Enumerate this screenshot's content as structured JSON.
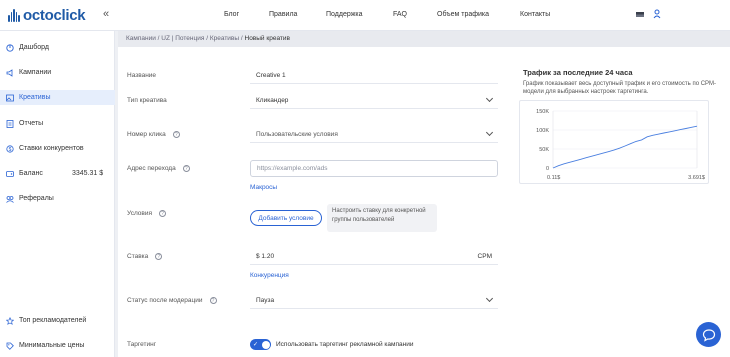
{
  "header": {
    "logo_text": "octoclick",
    "nav": [
      "Блог",
      "Правила",
      "Поддержка",
      "FAQ",
      "Объем трафика",
      "Контакты"
    ]
  },
  "sidebar": {
    "items": [
      {
        "label": "Дашборд",
        "icon": "dashboard-icon"
      },
      {
        "label": "Кампании",
        "icon": "megaphone-icon"
      },
      {
        "label": "Креативы",
        "icon": "image-icon",
        "active": true
      },
      {
        "label": "Отчеты",
        "icon": "report-icon"
      },
      {
        "label": "Ставки конкурентов",
        "icon": "bids-icon"
      },
      {
        "label": "Баланс",
        "icon": "wallet-icon",
        "value": "3345.31 $"
      },
      {
        "label": "Рефералы",
        "icon": "referrals-icon"
      }
    ],
    "bottom_items": [
      {
        "label": "Топ рекламодателей",
        "icon": "top-icon"
      },
      {
        "label": "Минимальные цены",
        "icon": "price-icon"
      }
    ]
  },
  "breadcrumb": {
    "items": [
      "Кампании",
      "UZ | Потенция",
      "Креативы"
    ],
    "separator": "/",
    "current": "Новый креатив"
  },
  "form": {
    "name_label": "Название",
    "name_value": "Creative 1",
    "type_label": "Тип креатива",
    "type_value": "Кликандер",
    "click_number_label": "Номер клика",
    "click_number_value": "Пользовательские условия",
    "url_label": "Адрес перехода",
    "url_placeholder": "https://example.com/ads",
    "macros_link": "Макросы",
    "conditions_label": "Условия",
    "add_condition_button": "Добавить условие",
    "conditions_hint": "Настроить ставку для конкретной группы пользователей",
    "bid_label": "Ставка",
    "bid_value": "$ 1.20",
    "bid_unit": "CPM",
    "competition_link": "Конкуренция",
    "moderation_label": "Статус после модерации",
    "moderation_value": "Пауза",
    "targeting_label": "Таргетинг",
    "targeting_toggle_label": "Использовать таргетинг рекламной кампании",
    "targeting_enabled": true
  },
  "traffic_card": {
    "title": "Трафик за последние 24 часа",
    "description": "График показывает весь доступный трафик и его стоимость по CPM-модели для выбранных настроек таргетинга."
  },
  "chart_data": {
    "type": "line",
    "x_min_label": "0.11$",
    "x_max_label": "3.691$",
    "y_ticks": [
      "150K",
      "100K",
      "50K",
      "0"
    ],
    "ylim": [
      0,
      150000
    ],
    "series": [
      {
        "values": [
          0,
          6000,
          11000,
          15000,
          19000,
          23000,
          27000,
          31000,
          35000,
          39000,
          43000,
          47000,
          52000,
          58000,
          64000,
          70000,
          74000,
          82000,
          86000,
          89000,
          92000,
          95000,
          98000,
          101000,
          104000,
          107000,
          110000
        ]
      }
    ],
    "color": "#4a7fe0",
    "grid": true
  },
  "colors": {
    "accent": "#2a63d4",
    "logo": "#1f5aa6",
    "active_bg": "#e6eefc"
  }
}
